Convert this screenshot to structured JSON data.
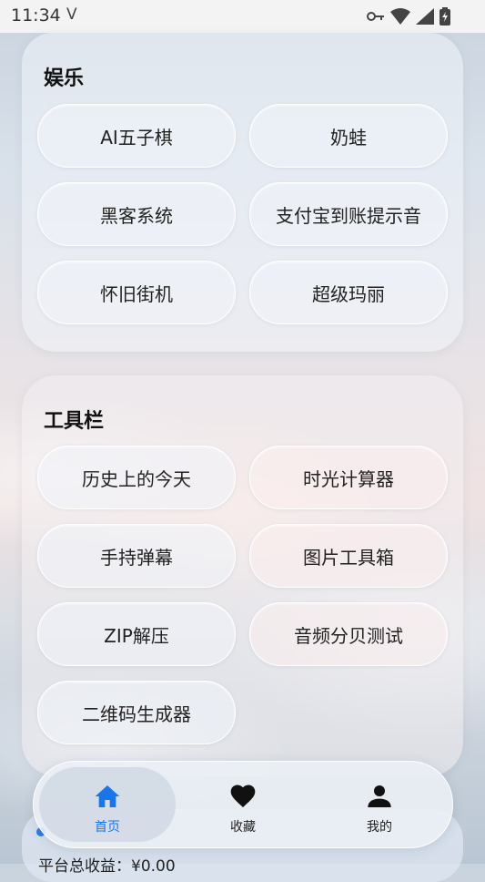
{
  "status": {
    "time": "11:34",
    "carrier_glyph": "V"
  },
  "entertainment": {
    "title": "娱乐",
    "buttons": [
      "AI五子棋",
      "奶蛙",
      "黑客系统",
      "支付宝到账提示音",
      "怀旧街机",
      "超级玛丽"
    ]
  },
  "tools": {
    "title": "工具栏",
    "buttons": [
      "历史上的今天",
      "时光计算器",
      "手持弹幕",
      "图片工具箱",
      "ZIP解压",
      "音频分贝测试",
      "二维码生成器"
    ]
  },
  "summary": {
    "text": "平台总收益：¥0.00"
  },
  "tabbar": {
    "active_color": "#1976e8",
    "tabs": [
      {
        "label": "首页",
        "icon": "home-icon"
      },
      {
        "label": "收藏",
        "icon": "heart-icon"
      },
      {
        "label": "我的",
        "icon": "person-icon"
      }
    ]
  }
}
